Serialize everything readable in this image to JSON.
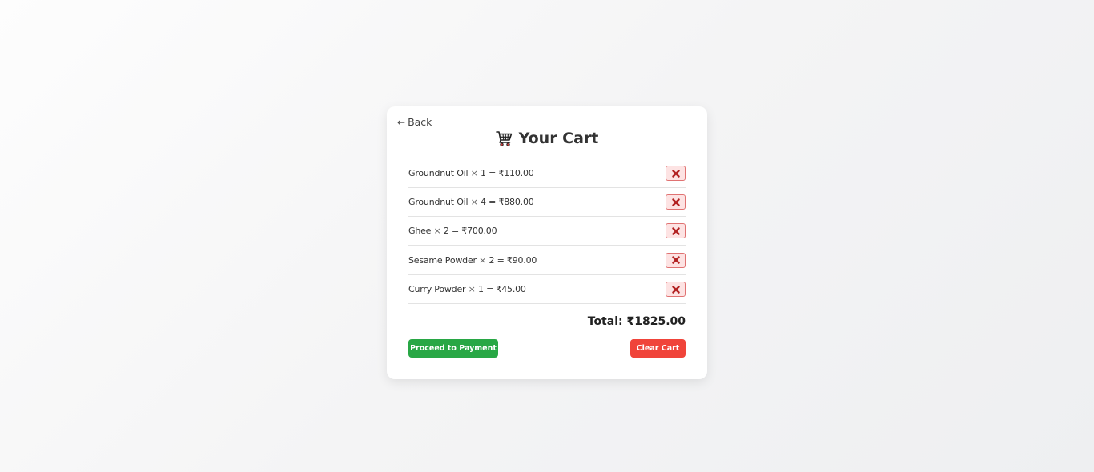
{
  "back_link": {
    "label": "Back",
    "arrow": "←"
  },
  "title": "Your Cart",
  "cart_icon": "shopping-cart-icon",
  "items": [
    {
      "name": "Groundnut Oil",
      "quantity": "1",
      "subtotal": "₹110.00"
    },
    {
      "name": "Groundnut Oil",
      "quantity": "4",
      "subtotal": "₹880.00"
    },
    {
      "name": "Ghee",
      "quantity": "2",
      "subtotal": "₹700.00"
    },
    {
      "name": "Sesame Powder",
      "quantity": "2",
      "subtotal": "₹90.00"
    },
    {
      "name": "Curry Powder",
      "quantity": "1",
      "subtotal": "₹45.00"
    }
  ],
  "remove_icon": "close-icon",
  "total": {
    "label": "Total:",
    "value": "₹1825.00"
  },
  "actions": {
    "proceed_label": "Proceed to Payment",
    "clear_label": "Clear Cart"
  },
  "colors": {
    "pay_button": "#28a745",
    "clear_button": "#f0443a",
    "remove_bg": "#fde3e3",
    "remove_border": "#e07272",
    "remove_icon": "#b22222"
  }
}
